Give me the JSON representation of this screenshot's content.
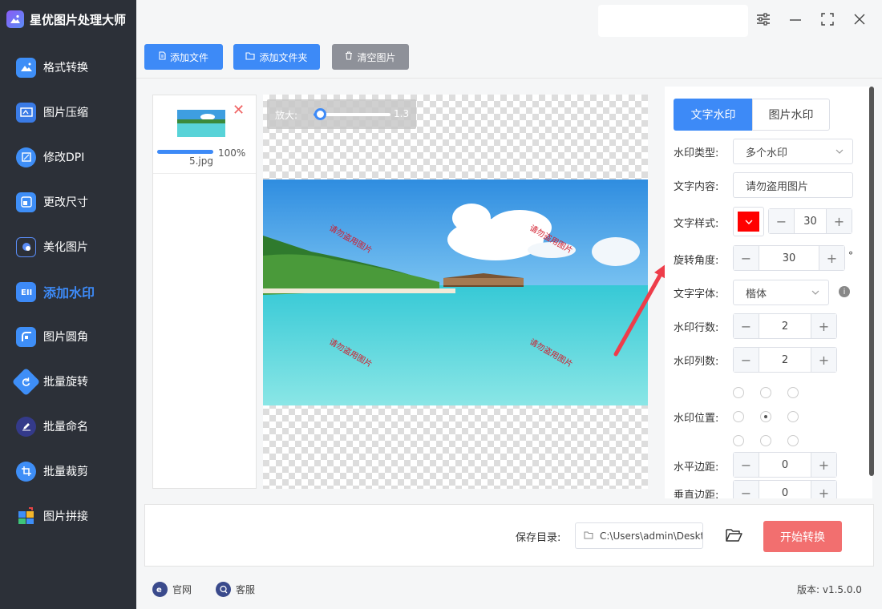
{
  "app": {
    "title": "星优图片处理大师"
  },
  "sidebar": {
    "items": [
      {
        "label": "格式转换",
        "icon": "image-convert-icon"
      },
      {
        "label": "图片压缩",
        "icon": "compress-icon"
      },
      {
        "label": "修改DPI",
        "icon": "dpi-icon"
      },
      {
        "label": "更改尺寸",
        "icon": "resize-icon"
      },
      {
        "label": "美化图片",
        "icon": "beautify-icon"
      },
      {
        "label": "添加水印",
        "icon": "watermark-icon",
        "active": true
      },
      {
        "label": "图片圆角",
        "icon": "round-corner-icon"
      },
      {
        "label": "批量旋转",
        "icon": "rotate-icon"
      },
      {
        "label": "批量命名",
        "icon": "rename-icon"
      },
      {
        "label": "批量裁剪",
        "icon": "crop-icon"
      },
      {
        "label": "图片拼接",
        "icon": "stitch-icon"
      }
    ]
  },
  "toolbar": {
    "add_file": "添加文件",
    "add_folder": "添加文件夹",
    "clear": "清空图片"
  },
  "file_list": {
    "items": [
      {
        "name": "5.jpg",
        "progress_text": "100%",
        "progress": 1.0
      }
    ]
  },
  "preview": {
    "zoom_label": "放大:",
    "zoom_value": "1.3",
    "zoom_fraction": 0.12,
    "watermark_text": "请勿盗用图片"
  },
  "settings": {
    "tabs": [
      "文字水印",
      "图片水印"
    ],
    "active_tab": 0,
    "type_label": "水印类型:",
    "type_value": "多个水印",
    "content_label": "文字内容:",
    "content_value": "请勿盗用图片",
    "style_label": "文字样式:",
    "color": "#ff0000",
    "font_size": "30",
    "angle_label": "旋转角度:",
    "angle_value": "30",
    "angle_unit": "°",
    "font_label": "文字字体:",
    "font_value": "楷体",
    "rows_label": "水印行数:",
    "rows_value": "2",
    "cols_label": "水印列数:",
    "cols_value": "2",
    "position_label": "水印位置:",
    "position_selected": "center",
    "hmargin_label": "水平边距:",
    "hmargin_value": "0",
    "vmargin_label": "垂直边距:",
    "vmargin_value": "0"
  },
  "save": {
    "label": "保存目录:",
    "path": "C:\\Users\\admin\\Deskto",
    "start_button": "开始转换"
  },
  "footer": {
    "website": "官网",
    "support": "客服",
    "version": "版本: v1.5.0.0"
  },
  "colors": {
    "primary": "#3d8af7",
    "start": "#f26f6f",
    "sidebar": "#2c3038",
    "annotation_arrow": "#ee3d4a"
  }
}
